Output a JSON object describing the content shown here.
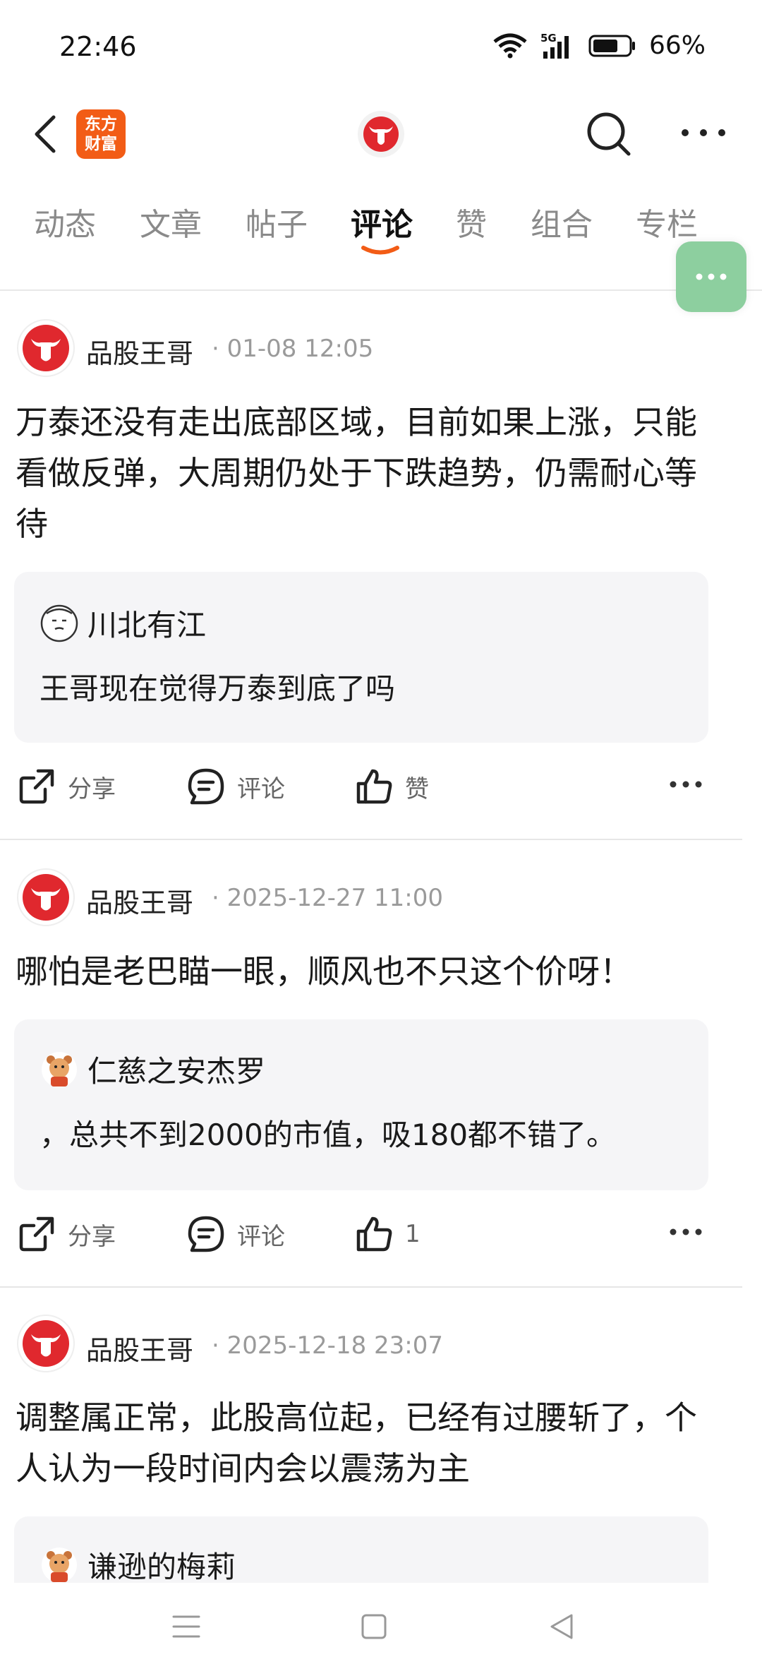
{
  "status_bar": {
    "time": "22:46",
    "network": "5G",
    "battery": "66%"
  },
  "nav": {
    "brand_line1": "东方",
    "brand_line2": "财富"
  },
  "tabs": [
    {
      "label": "动态"
    },
    {
      "label": "文章"
    },
    {
      "label": "帖子"
    },
    {
      "label": "评论",
      "active": true
    },
    {
      "label": "赞"
    },
    {
      "label": "组合"
    },
    {
      "label": "专栏"
    }
  ],
  "posts": [
    {
      "author": "品股王哥",
      "time": "· 01-08 12:05",
      "body": "万泰还没有走出底部区域，目前如果上涨，只能看做反弹，大周期仍处于下跌趋势，仍需耐心等待",
      "quote_user": "川北有江",
      "quote_text": "王哥现在觉得万泰到底了吗",
      "share_label": "分享",
      "comment_label": "评论",
      "like_label": "赞"
    },
    {
      "author": "品股王哥",
      "time": "· 2025-12-27 11:00",
      "body": "哪怕是老巴瞄一眼，顺风也不只这个价呀！",
      "quote_user": "仁慈之安杰罗",
      "quote_text": "，总共不到2000的市值，吸180都不错了。",
      "share_label": "分享",
      "comment_label": "评论",
      "like_label": "1"
    },
    {
      "author": "品股王哥",
      "time": "· 2025-12-18 23:07",
      "body": "调整属正常，此股高位起，已经有过腰斩了，个人认为一段时间内会以震荡为主",
      "quote_user": "谦逊的梅莉"
    }
  ],
  "colors": {
    "accent": "#f25c16",
    "brand_red": "#e0282e",
    "fab": "#8dcf9f"
  }
}
